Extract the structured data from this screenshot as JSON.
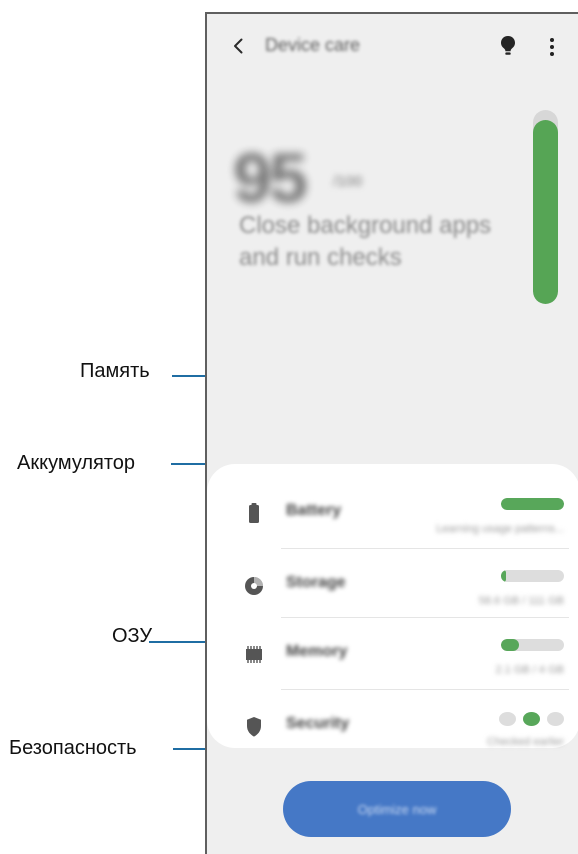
{
  "screen": {
    "title": "Device care",
    "score": "95",
    "score_unit": "/100",
    "message": "Close background apps and run checks",
    "score_level": 0.95,
    "cards": [
      {
        "label": "Battery",
        "status": "Learning usage patterns...",
        "icon": "battery-icon",
        "level": 1.0
      },
      {
        "label": "Storage",
        "status": "58.6 GB / 111 GB",
        "icon": "storage-icon",
        "level": 0.08
      },
      {
        "label": "Memory",
        "status": "2.1 GB / 4 GB",
        "icon": "memory-icon",
        "level": 0.28
      },
      {
        "label": "Security",
        "status": "Checked earlier",
        "icon": "shield-icon",
        "active_dot": 1
      }
    ],
    "optimize_label": "Optimize now",
    "colors": {
      "background": "#efefef",
      "accent": "#58a75a",
      "button": "#4578c6",
      "callout": "#1f6da3"
    },
    "icons": [
      "back-arrow-icon",
      "lightbulb-icon",
      "more-options-icon"
    ]
  },
  "callouts": [
    {
      "label": "Аккумулятор"
    },
    {
      "label": "Память"
    },
    {
      "label": "ОЗУ"
    },
    {
      "label": "Безопасность"
    }
  ]
}
